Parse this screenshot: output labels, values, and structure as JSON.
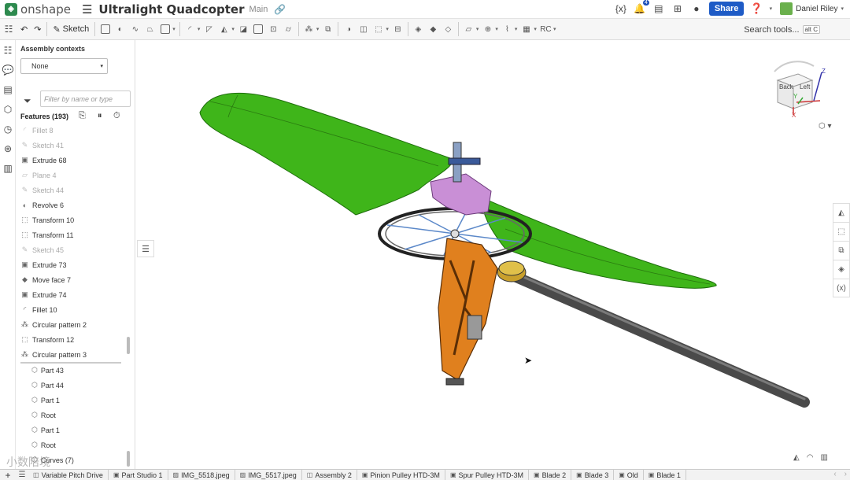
{
  "app": {
    "logo_text": "onshape",
    "document_title": "Ultralight Quadcopter",
    "branch": "Main",
    "notification_count": "4",
    "share_label": "Share",
    "user_name": "Daniel Riley"
  },
  "toolbar": {
    "sketch_label": "Sketch",
    "search_label": "Search tools...",
    "search_shortcut": "alt C"
  },
  "panel": {
    "assembly_contexts_label": "Assembly contexts",
    "assembly_context_value": "None",
    "filter_placeholder": "Filter by name or type",
    "features_header": "Features (193)",
    "features": [
      {
        "label": "Fillet 8",
        "icon": "fillet-icon",
        "suppressed": true
      },
      {
        "label": "Sketch 41",
        "icon": "sketch-icon",
        "suppressed": true
      },
      {
        "label": "Extrude 68",
        "icon": "extrude-icon",
        "suppressed": false
      },
      {
        "label": "Plane 4",
        "icon": "plane-icon",
        "suppressed": true
      },
      {
        "label": "Sketch 44",
        "icon": "sketch-icon",
        "suppressed": true
      },
      {
        "label": "Revolve 6",
        "icon": "revolve-icon",
        "suppressed": false
      },
      {
        "label": "Transform 10",
        "icon": "transform-icon",
        "suppressed": false
      },
      {
        "label": "Transform 11",
        "icon": "transform-icon",
        "suppressed": false
      },
      {
        "label": "Sketch 45",
        "icon": "sketch-icon",
        "suppressed": true
      },
      {
        "label": "Extrude 73",
        "icon": "extrude-icon",
        "suppressed": false
      },
      {
        "label": "Move face 7",
        "icon": "move-face-icon",
        "suppressed": false
      },
      {
        "label": "Extrude 74",
        "icon": "extrude-icon",
        "suppressed": false
      },
      {
        "label": "Fillet 10",
        "icon": "fillet-icon",
        "suppressed": false
      },
      {
        "label": "Circular pattern 2",
        "icon": "circular-pattern-icon",
        "suppressed": false
      },
      {
        "label": "Transform 12",
        "icon": "transform-icon",
        "suppressed": false
      },
      {
        "label": "Circular pattern 3",
        "icon": "circular-pattern-icon",
        "suppressed": false
      }
    ],
    "parts": [
      {
        "label": "Part 43"
      },
      {
        "label": "Part 44"
      },
      {
        "label": "Part 1"
      },
      {
        "label": "Root"
      },
      {
        "label": "Part 1"
      },
      {
        "label": "Root"
      },
      {
        "label": "Curves (7)"
      }
    ]
  },
  "viewcube": {
    "back_label": "Back",
    "left_label": "Left",
    "axis_x": "X",
    "axis_y": "Y",
    "axis_z": "Z"
  },
  "tabs": [
    {
      "label": "Variable Pitch Drive",
      "icon": "assembly-tab-icon"
    },
    {
      "label": "Part Studio 1",
      "icon": "part-studio-tab-icon"
    },
    {
      "label": "IMG_5518.jpeg",
      "icon": "image-tab-icon"
    },
    {
      "label": "IMG_5517.jpeg",
      "icon": "image-tab-icon"
    },
    {
      "label": "Assembly 2",
      "icon": "assembly-tab-icon"
    },
    {
      "label": "Pinion Pulley HTD-3M",
      "icon": "part-studio-tab-icon"
    },
    {
      "label": "Spur Pulley HTD-3M",
      "icon": "part-studio-tab-icon"
    },
    {
      "label": "Blade 2",
      "icon": "part-studio-tab-icon"
    },
    {
      "label": "Blade 3",
      "icon": "part-studio-tab-icon"
    },
    {
      "label": "Old",
      "icon": "part-studio-tab-icon"
    },
    {
      "label": "Blade 1",
      "icon": "part-studio-tab-icon"
    }
  ],
  "watermark": "小数陪境",
  "colors": {
    "blade_green": "#3fb51a",
    "bracket_orange": "#e0801e",
    "bracket_purple": "#c98fd6",
    "share_blue": "#1e5bc6",
    "shaft_gray": "#555555"
  }
}
